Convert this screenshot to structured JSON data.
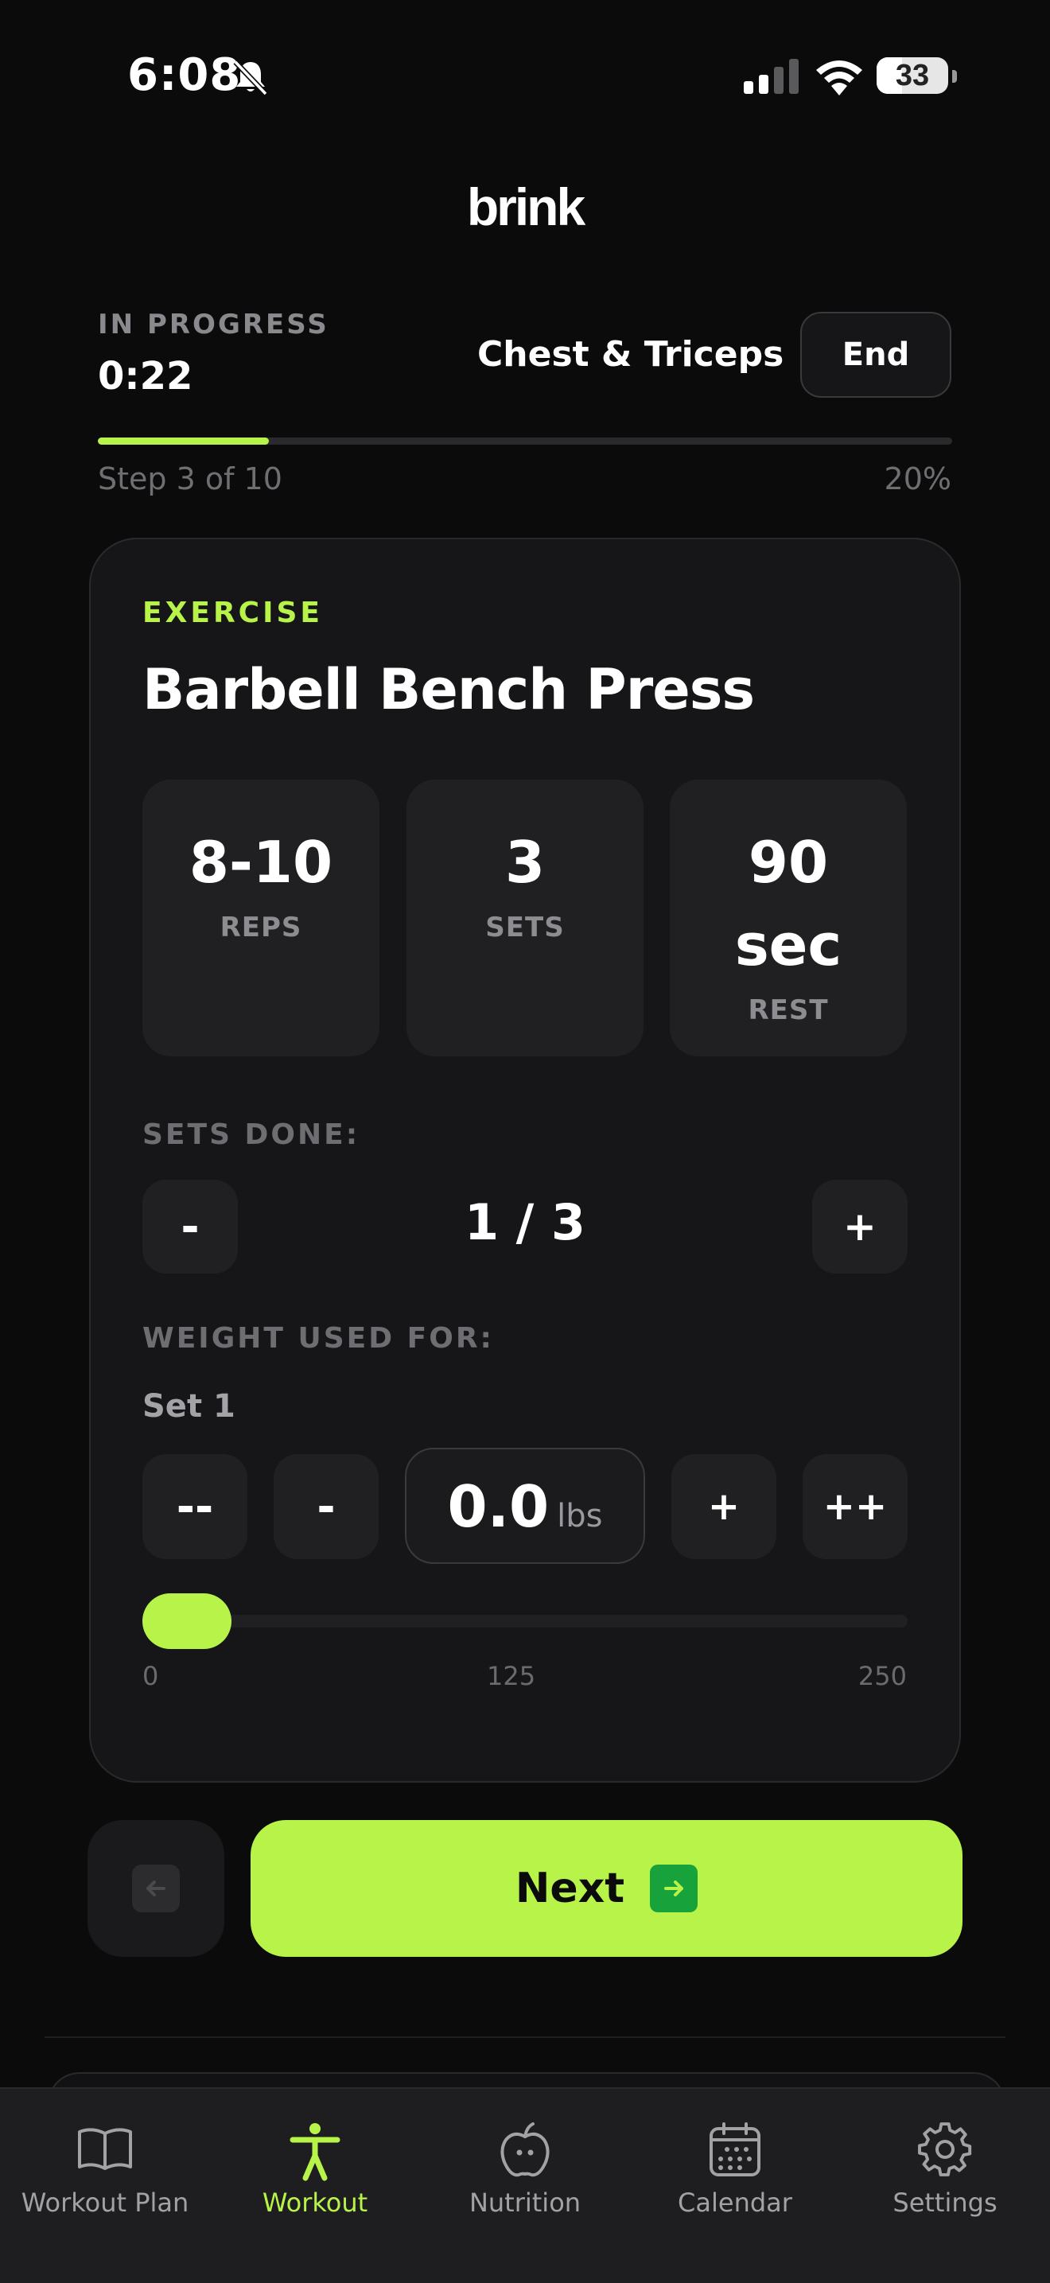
{
  "status_bar": {
    "time": "6:08",
    "battery": "33"
  },
  "app": {
    "logo": "brink"
  },
  "session": {
    "status_label": "IN PROGRESS",
    "elapsed": "0:22",
    "workout_name": "Chest & Triceps",
    "end_label": "End",
    "step_text": "Step 3 of 10",
    "percent_text": "20%",
    "progress_fraction": 0.2
  },
  "exercise": {
    "section_label": "EXERCISE",
    "name": "Barbell Bench Press",
    "stats": [
      {
        "value": "8-10",
        "label": "REPS"
      },
      {
        "value": "3",
        "label": "SETS"
      },
      {
        "value_line1": "90",
        "value_line2": "sec",
        "label": "REST"
      }
    ],
    "sets_done": {
      "label": "SETS DONE:",
      "value": "1 / 3",
      "minus": "-",
      "plus": "+"
    },
    "weight": {
      "label": "WEIGHT USED FOR:",
      "set_label": "Set 1",
      "value": "0.0",
      "unit": "lbs",
      "dec_big": "--",
      "dec": "-",
      "inc": "+",
      "inc_big": "++",
      "slider": {
        "min": "0",
        "mid": "125",
        "max": "250",
        "current": 0
      }
    }
  },
  "nav": {
    "next_label": "Next"
  },
  "tabs": [
    {
      "label": "Workout Plan",
      "icon": "book-icon"
    },
    {
      "label": "Workout",
      "icon": "person-icon",
      "active": true
    },
    {
      "label": "Nutrition",
      "icon": "apple-icon"
    },
    {
      "label": "Calendar",
      "icon": "calendar-icon"
    },
    {
      "label": "Settings",
      "icon": "gear-icon"
    }
  ],
  "colors": {
    "accent": "#b8f34a",
    "background": "#0b0b0c",
    "card": "#161618",
    "next_icon": "#17a23b"
  }
}
